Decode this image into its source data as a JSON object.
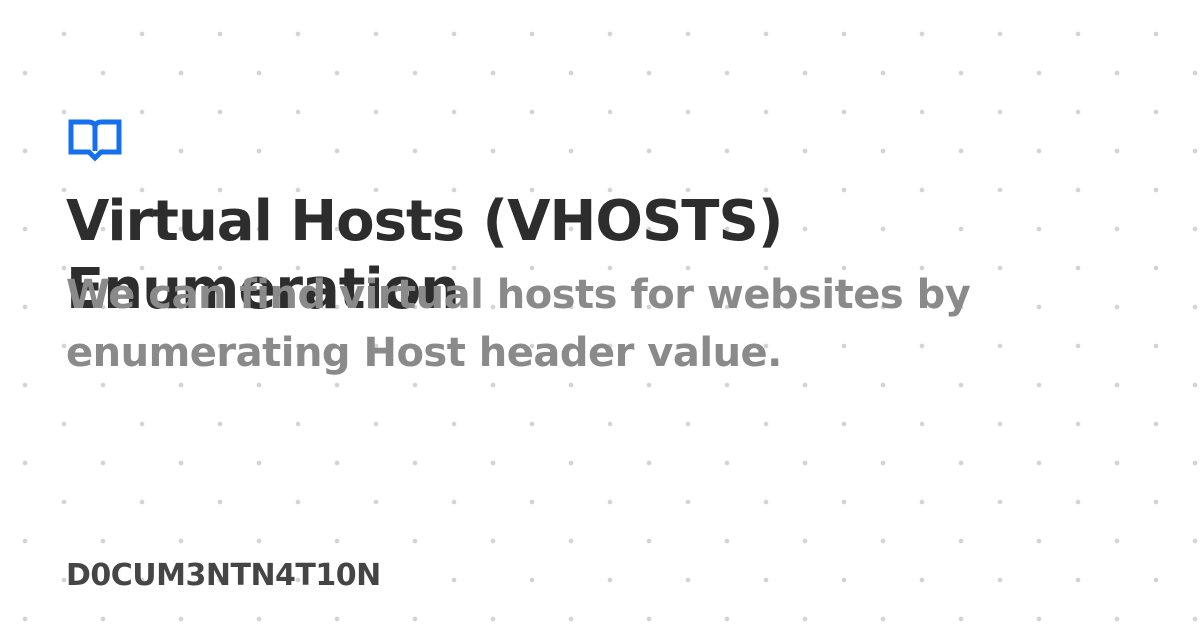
{
  "brand": {
    "logo_icon": "open-book-icon",
    "accent_color": "#1570ef",
    "site_name": "D0CUM3NTN4T10N"
  },
  "page": {
    "title": "Virtual Hosts (VHOSTS) Enumeration",
    "description": "We can find virtual hosts for websites by enumerating Host header value."
  }
}
